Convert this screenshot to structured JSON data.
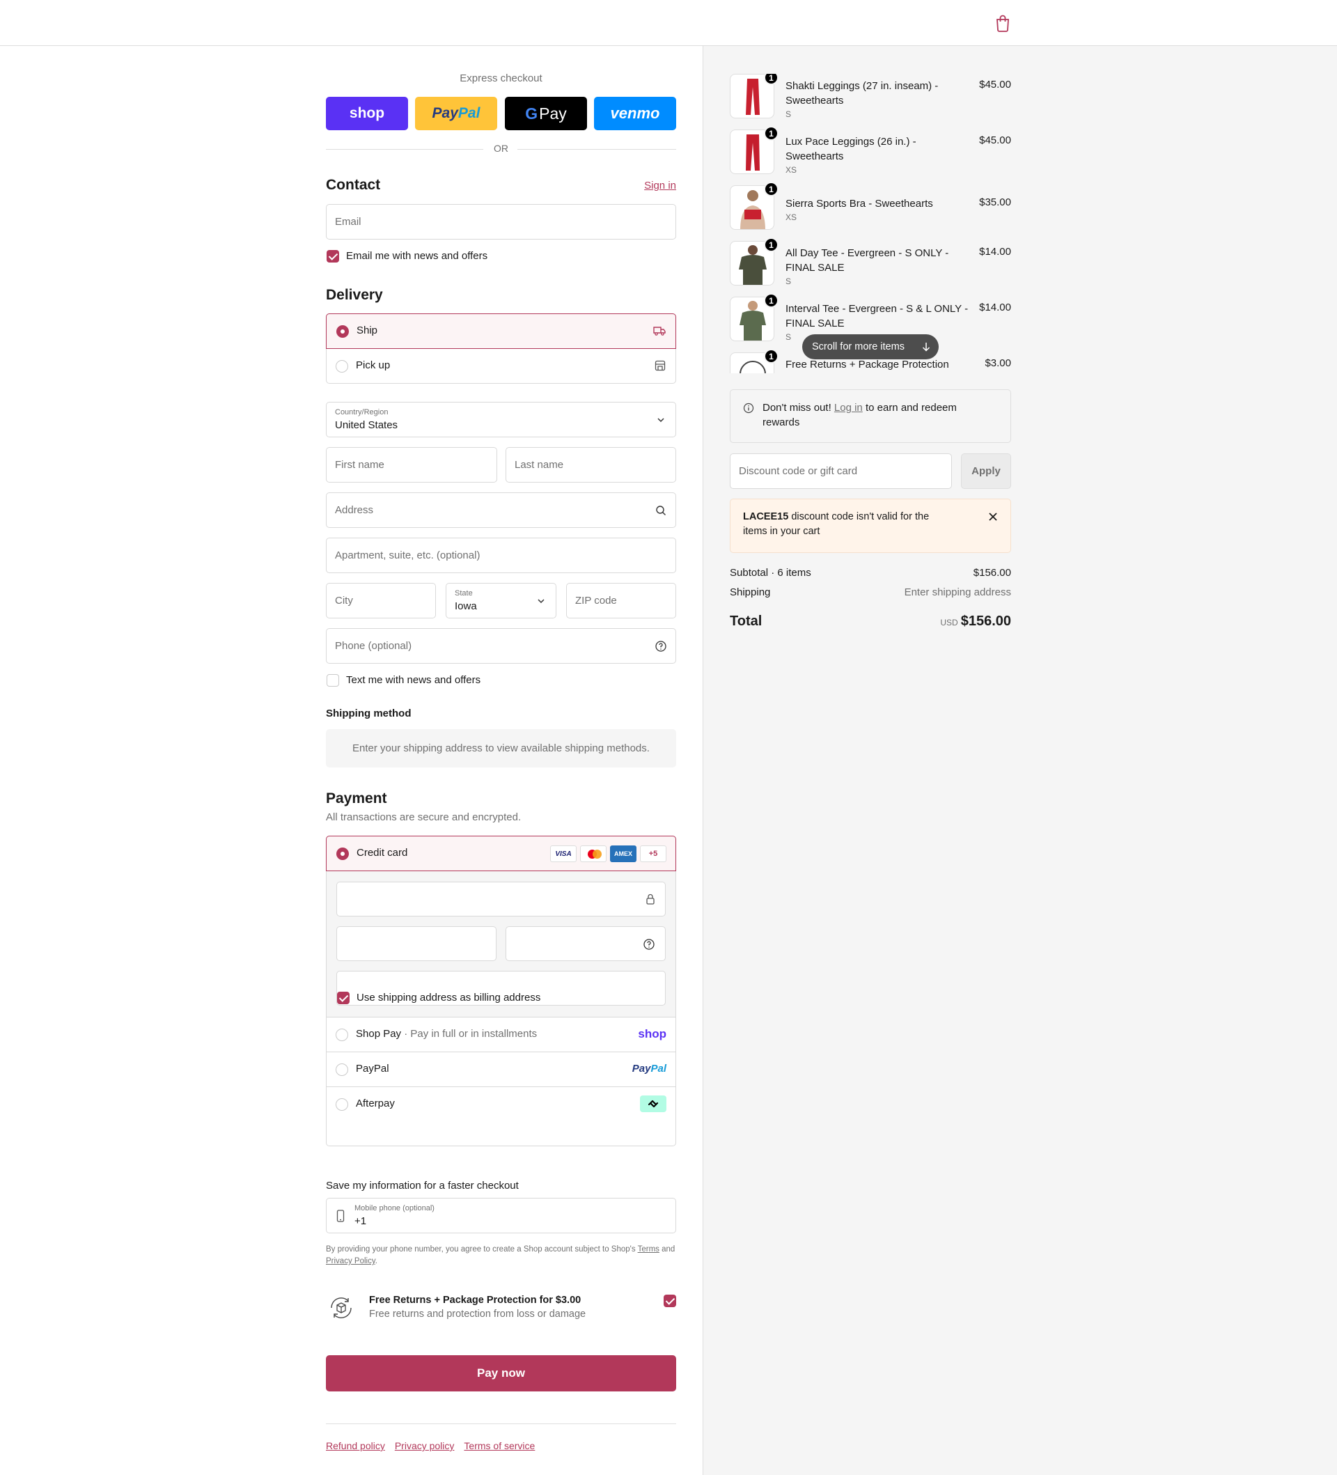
{
  "express": {
    "title": "Express checkout",
    "buttons": {
      "shop": "shop",
      "paypal_a": "Pay",
      "paypal_b": "Pal",
      "gpay_g": "G",
      "gpay_text": "Pay",
      "venmo": "venmo"
    },
    "or": "OR"
  },
  "contact": {
    "heading": "Contact",
    "sign_in": "Sign in",
    "email_placeholder": "Email",
    "news_label": "Email me with news and offers"
  },
  "delivery": {
    "heading": "Delivery",
    "ship": "Ship",
    "pickup": "Pick up",
    "country_label": "Country/Region",
    "country_value": "United States",
    "first_name": "First name",
    "last_name": "Last name",
    "address": "Address",
    "apartment": "Apartment, suite, etc. (optional)",
    "city": "City",
    "state_label": "State",
    "state_value": "Iowa",
    "zip": "ZIP code",
    "phone": "Phone (optional)",
    "text_label": "Text me with news and offers"
  },
  "shipping_method": {
    "heading": "Shipping method",
    "message": "Enter your shipping address to view available shipping methods."
  },
  "payment": {
    "heading": "Payment",
    "subtitle": "All transactions are secure and encrypted.",
    "credit_card": "Credit card",
    "card_brands": {
      "visa": "VISA",
      "amex": "AMEX",
      "more": "+5"
    },
    "billing_label": "Use shipping address as billing address",
    "shop_pay": "Shop Pay",
    "shop_pay_sub": "Pay in full or in installments",
    "shop_pay_logo": "shop",
    "paypal": "PayPal",
    "paypal_logo_a": "Pay",
    "paypal_logo_b": "Pal",
    "afterpay": "Afterpay"
  },
  "save_info": {
    "heading": "Save my information for a faster checkout",
    "phone_label": "Mobile phone (optional)",
    "phone_value": "+1",
    "legal_prefix": "By providing your phone number, you agree to create a Shop account subject to Shop's",
    "terms": "Terms",
    "and": "and",
    "privacy": "Privacy Policy",
    "period": "."
  },
  "protection": {
    "title": "Free Returns + Package Protection for $3.00",
    "subtitle": "Free returns and protection from loss or damage"
  },
  "pay_now": "Pay now",
  "footer": {
    "refund": "Refund policy",
    "privacy": "Privacy policy",
    "terms": "Terms of service"
  },
  "cart": {
    "items": [
      {
        "qty": "1",
        "name": "Shakti Leggings (27 in. inseam) - Sweethearts",
        "variant": "S",
        "price": "$45.00"
      },
      {
        "qty": "1",
        "name": "Lux Pace Leggings (26 in.) - Sweethearts",
        "variant": "XS",
        "price": "$45.00"
      },
      {
        "qty": "1",
        "name": "Sierra Sports Bra - Sweethearts",
        "variant": "XS",
        "price": "$35.00"
      },
      {
        "qty": "1",
        "name": "All Day Tee - Evergreen - S ONLY - FINAL SALE",
        "variant": "S",
        "price": "$14.00"
      },
      {
        "qty": "1",
        "name": "Interval Tee - Evergreen - S & L ONLY - FINAL SALE",
        "variant": "S",
        "price": "$14.00"
      },
      {
        "qty": "1",
        "name": "Free Returns + Package Protection",
        "variant": "",
        "price": "$3.00"
      }
    ],
    "scroll_more": "Scroll for more items",
    "rewards_prefix": "Don't miss out!",
    "rewards_link": "Log in",
    "rewards_suffix": "to earn and redeem rewards",
    "discount_placeholder": "Discount code or gift card",
    "apply": "Apply",
    "error_code": "LACEE15",
    "error_text": "discount code isn't valid for the items in your cart",
    "subtotal_label": "Subtotal · 6 items",
    "subtotal_value": "$156.00",
    "shipping_label": "Shipping",
    "shipping_value": "Enter shipping address",
    "total_label": "Total",
    "currency": "USD",
    "total_value": "$156.00"
  },
  "colors": {
    "accent": "#b2385a",
    "shop_purple": "#5a31f4",
    "paypal_yellow": "#ffc439",
    "venmo_blue": "#008cff"
  }
}
